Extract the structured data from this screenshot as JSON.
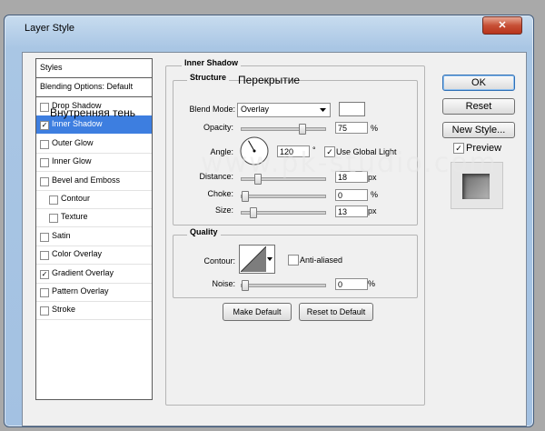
{
  "window": {
    "title": "Layer Style",
    "close_glyph": "✕"
  },
  "watermark": "www.pk-studio.com",
  "styles": {
    "header": "Styles",
    "blending": "Blending Options: Default",
    "items": [
      {
        "label": "Drop Shadow",
        "checked": false
      },
      {
        "label": "Inner Shadow",
        "checked": true,
        "selected": true
      },
      {
        "label": "Outer Glow",
        "checked": false
      },
      {
        "label": "Inner Glow",
        "checked": false
      },
      {
        "label": "Bevel and Emboss",
        "checked": false
      },
      {
        "label": "Contour",
        "checked": false,
        "indent": true
      },
      {
        "label": "Texture",
        "checked": false,
        "indent": true
      },
      {
        "label": "Satin",
        "checked": false
      },
      {
        "label": "Color Overlay",
        "checked": false
      },
      {
        "label": "Gradient Overlay",
        "checked": true
      },
      {
        "label": "Pattern Overlay",
        "checked": false
      },
      {
        "label": "Stroke",
        "checked": false
      }
    ],
    "check_glyph": "✓"
  },
  "panel": {
    "title": "Inner Shadow",
    "structure": {
      "title": "Structure",
      "blend_mode_label": "Blend Mode:",
      "blend_mode_value": "Overlay",
      "color": "#ffffff",
      "opacity_label": "Opacity:",
      "opacity_value": "75",
      "opacity_fraction": 0.75,
      "angle_label": "Angle:",
      "angle_value": "120",
      "angle_unit": "°",
      "global_light_label": "Use Global Light",
      "global_light_checked": true,
      "distance_label": "Distance:",
      "distance_value": "18",
      "distance_unit": "px",
      "distance_fraction": 0.072,
      "choke_label": "Choke:",
      "choke_value": "0",
      "choke_unit": "%",
      "choke_fraction": 0.0,
      "size_label": "Size:",
      "size_value": "13",
      "size_unit": "px",
      "size_fraction": 0.052,
      "percent": "%"
    },
    "quality": {
      "title": "Quality",
      "contour_label": "Contour:",
      "anti_aliased_label": "Anti-aliased",
      "anti_aliased_checked": false,
      "noise_label": "Noise:",
      "noise_value": "0",
      "noise_unit": "%",
      "noise_fraction": 0.0
    },
    "make_default": "Make Default",
    "reset_default": "Reset to Default"
  },
  "buttons": {
    "ok": "OK",
    "reset": "Reset",
    "new_style": "New Style...",
    "preview_label": "Preview",
    "preview_checked": true
  },
  "annotations": {
    "inner_shadow_ru": "Внутренняя тень",
    "overlay_ru": "Перекрытие"
  }
}
